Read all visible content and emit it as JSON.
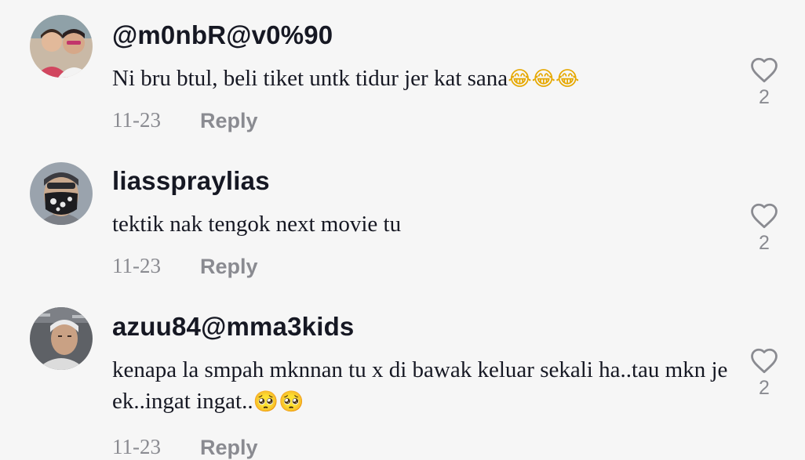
{
  "comments": [
    {
      "username": "@m0nbR@v0%90",
      "text": "Ni bru btul, beli tiket untk tidur jer kat sana",
      "emojis": "😂😂😂",
      "date": "11-23",
      "reply_label": "Reply",
      "likes": "2",
      "avatar_icon": "avatar-two-people-photo"
    },
    {
      "username": "liasspraylias",
      "text": "tektik nak tengok next movie tu",
      "emojis": "",
      "date": "11-23",
      "reply_label": "Reply",
      "likes": "2",
      "avatar_icon": "avatar-masked-person-photo"
    },
    {
      "username": "azuu84@mma3kids",
      "text": "kenapa la smpah mknnan tu x di bawak keluar sekali ha..tau mkn je ek..ingat ingat..",
      "emojis": "🥺🥺",
      "date": "11-23",
      "reply_label": "Reply",
      "likes": "2",
      "avatar_icon": "avatar-person-selfie-photo"
    }
  ],
  "colors": {
    "background": "#f6f6f6",
    "username": "#161823",
    "body_text": "#161823",
    "muted": "#8a8b91"
  }
}
